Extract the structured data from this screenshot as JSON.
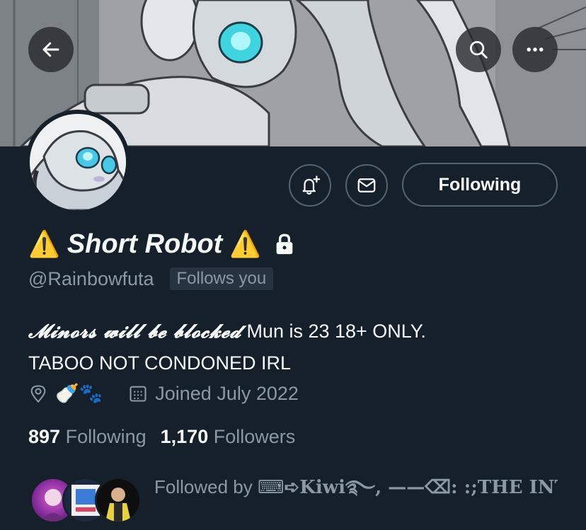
{
  "header": {
    "back_icon": "arrow-left-icon",
    "search_icon": "search-icon",
    "more_icon": "more-horizontal-icon"
  },
  "actions": {
    "notify_icon": "bell-plus-icon",
    "message_icon": "mail-icon",
    "following_label": "Following"
  },
  "profile": {
    "warning_emoji": "⚠️",
    "display_name": "Short Robot",
    "protected_icon": "lock-icon",
    "handle": "@Rainbowfuta",
    "follows_you": "Follows you",
    "bio_fancy": "𝓜𝓲𝓷𝓸𝓻𝓼 𝔀𝓲𝓵𝓵 𝓫𝓮 𝓫𝓵𝓸𝓬𝓴𝓮𝓭",
    "bio_rest": "Mun is 23 18+ ONLY.",
    "bio_line2": "TABOO NOT CONDONED IRL",
    "location_emojis": "🍼🐾",
    "joined": "Joined July 2022"
  },
  "stats": {
    "following_count": "897",
    "following_label": "Following",
    "followers_count": "1,170",
    "followers_label": "Followers"
  },
  "followed_by": {
    "prefix": "Followed by",
    "names": "⌨➪Kiwi࿐, ——⌫: :;THE INT..."
  },
  "colors": {
    "background": "#15202b",
    "secondary_text": "#8b98a5",
    "border": "#536471"
  }
}
